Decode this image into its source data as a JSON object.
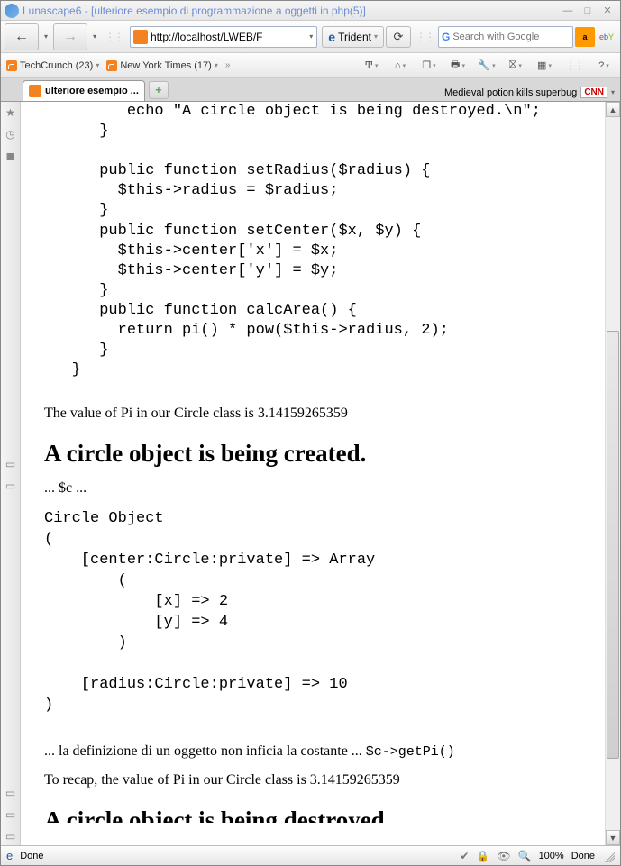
{
  "window": {
    "title": "Lunascape6 - [ulteriore esempio di programmazione a oggetti in php(5)]"
  },
  "toolbar": {
    "url": "http://localhost/LWEB/F",
    "engine": "Trident",
    "search_placeholder": "Search with Google"
  },
  "bookmarks": {
    "techcrunch": "TechCrunch (23)",
    "nyt": "New York Times (17)"
  },
  "tab": {
    "title": "ulteriore esempio ..."
  },
  "ticker": {
    "headline": "Medieval potion kills superbug",
    "source": "CNN"
  },
  "page": {
    "code1": "         echo \"A circle object is being destroyed.\\n\";\n      }\n\n      public function setRadius($radius) {\n        $this->radius = $radius;\n      }\n      public function setCenter($x, $y) {\n        $this->center['x'] = $x;\n        $this->center['y'] = $y;\n      }\n      public function calcArea() {\n        return pi() * pow($this->radius, 2);\n      }\n   }",
    "p1": "The value of Pi in our Circle class is 3.14159265359",
    "h1": "A circle object is being created.",
    "p2": "... $c ...",
    "pre2": "Circle Object\n(\n    [center:Circle:private] => Array\n        (\n            [x] => 2\n            [y] => 4\n        )\n\n    [radius:Circle:private] => 10\n)",
    "p3a": "... la definizione di un oggetto non inficia la costante ... ",
    "p3code": "$c->getPi()",
    "p4": "To recap, the value of Pi in our Circle class is 3.14159265359",
    "h2": "A circle object is being destroyed."
  },
  "status": {
    "left": "Done",
    "zoom": "100%",
    "right": "Done"
  }
}
